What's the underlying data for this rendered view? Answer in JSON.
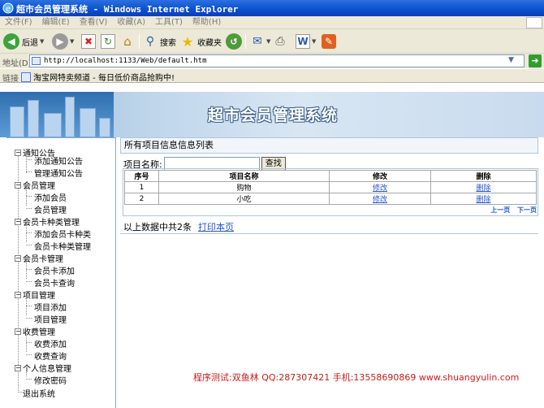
{
  "window": {
    "title": "超市会员管理系统 - Windows Internet Explorer"
  },
  "menu": [
    "文件(F)",
    "编辑(E)",
    "查看(V)",
    "收藏(A)",
    "工具(T)",
    "帮助(H)"
  ],
  "toolbar": {
    "back_label": "后退",
    "search_label": "搜索",
    "favorites_label": "收藏夹"
  },
  "address": {
    "label": "地址(D)",
    "url": "http://localhost:1133/Web/default.htm"
  },
  "links": {
    "label": "链接",
    "item": "淘宝网特卖频道 - 每日低价商品抢购中!"
  },
  "banner": {
    "title": "超市会员管理系统"
  },
  "sidebar": {
    "groups": [
      {
        "label": "通知公告",
        "items": [
          "添加通知公告",
          "管理通知公告"
        ]
      },
      {
        "label": "会员管理",
        "items": [
          "添加会员",
          "会员管理"
        ]
      },
      {
        "label": "会员卡种类管理",
        "items": [
          "添加会员卡种类",
          "会员卡种类管理"
        ]
      },
      {
        "label": "会员卡管理",
        "items": [
          "会员卡添加",
          "会员卡查询"
        ]
      },
      {
        "label": "项目管理",
        "items": [
          "项目添加",
          "项目管理"
        ]
      },
      {
        "label": "收费管理",
        "items": [
          "收费添加",
          "收费查询"
        ]
      },
      {
        "label": "个人信息管理",
        "items": [
          "修改密码"
        ]
      }
    ],
    "logout": "退出系统"
  },
  "main": {
    "title": "所有项目信息信息列表",
    "search_label": "项目名称:",
    "search_value": "",
    "search_button": "查找",
    "columns": [
      "序号",
      "项目名称",
      "修改",
      "删除"
    ],
    "rows": [
      {
        "no": "1",
        "name": "购物",
        "edit": "修改",
        "del": "删除"
      },
      {
        "no": "2",
        "name": "小吃",
        "edit": "修改",
        "del": "删除"
      }
    ],
    "pager": {
      "prev": "上一页",
      "next": "下一页"
    },
    "summary": "以上数据中共2条",
    "print_link": "打印本页"
  },
  "footer": {
    "text": "程序测试:双鱼林 QQ:287307421 手机:13558690869 www.shuangyulin.com"
  }
}
